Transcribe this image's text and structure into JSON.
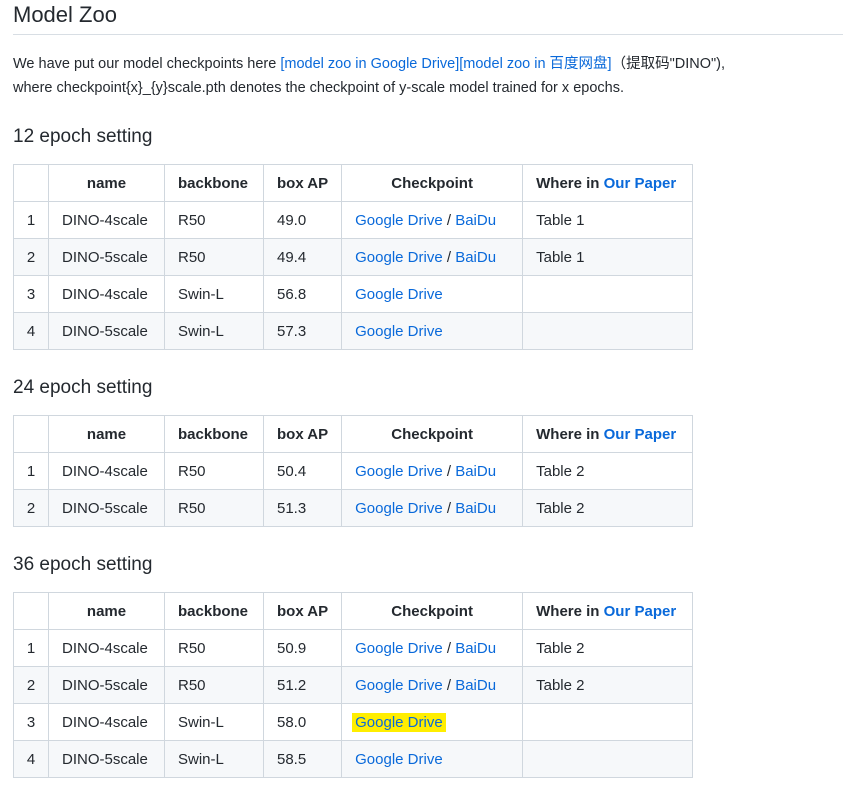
{
  "title": "Model Zoo",
  "intro": {
    "text_1": "We have put our model checkpoints here ",
    "link_google": "[model zoo in Google Drive]",
    "link_baidu": "[model zoo in 百度网盘]",
    "text_2": "（提取码\"DINO\"),",
    "text_3": "where checkpoint{x}_{y}scale.pth denotes the checkpoint of y-scale model trained for x epochs."
  },
  "headers": {
    "idx": "",
    "name": "name",
    "backbone": "backbone",
    "box_ap": "box AP",
    "checkpoint": "Checkpoint",
    "where_prefix": "Where in ",
    "where_link": "Our Paper"
  },
  "links": {
    "google": "Google Drive",
    "sep": " / ",
    "baidu": "BaiDu"
  },
  "sections": [
    {
      "heading": "12 epoch setting",
      "rows": [
        {
          "idx": "1",
          "name": "DINO-4scale",
          "backbone": "R50",
          "box_ap": "49.0",
          "where": "Table 1"
        },
        {
          "idx": "2",
          "name": "DINO-5scale",
          "backbone": "R50",
          "box_ap": "49.4",
          "where": "Table 1"
        },
        {
          "idx": "3",
          "name": "DINO-4scale",
          "backbone": "Swin-L",
          "box_ap": "56.8",
          "where": ""
        },
        {
          "idx": "4",
          "name": "DINO-5scale",
          "backbone": "Swin-L",
          "box_ap": "57.3",
          "where": ""
        }
      ]
    },
    {
      "heading": "24 epoch setting",
      "rows": [
        {
          "idx": "1",
          "name": "DINO-4scale",
          "backbone": "R50",
          "box_ap": "50.4",
          "where": "Table 2"
        },
        {
          "idx": "2",
          "name": "DINO-5scale",
          "backbone": "R50",
          "box_ap": "51.3",
          "where": "Table 2"
        }
      ]
    },
    {
      "heading": "36 epoch setting",
      "rows": [
        {
          "idx": "1",
          "name": "DINO-4scale",
          "backbone": "R50",
          "box_ap": "50.9",
          "where": "Table 2"
        },
        {
          "idx": "2",
          "name": "DINO-5scale",
          "backbone": "R50",
          "box_ap": "51.2",
          "where": "Table 2"
        },
        {
          "idx": "3",
          "name": "DINO-4scale",
          "backbone": "Swin-L",
          "box_ap": "58.0",
          "where": ""
        },
        {
          "idx": "4",
          "name": "DINO-5scale",
          "backbone": "Swin-L",
          "box_ap": "58.5",
          "where": ""
        }
      ]
    }
  ],
  "colors": {
    "link": "#0969da",
    "highlight": "#ffee00",
    "border": "#d0d7de",
    "stripe": "#f6f8fa"
  }
}
